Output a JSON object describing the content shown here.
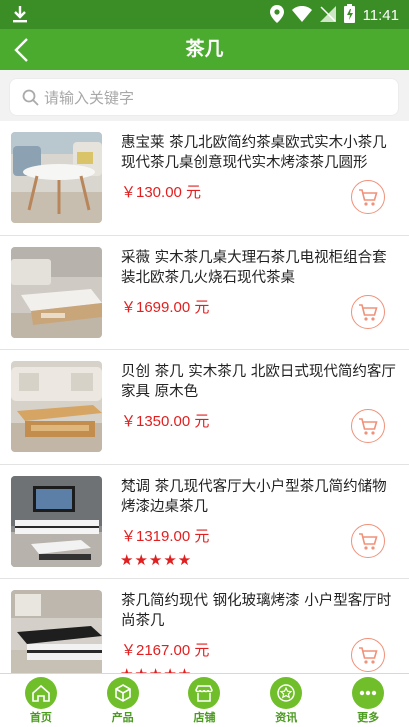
{
  "status_bar": {
    "time": "11:41"
  },
  "header": {
    "title": "茶几"
  },
  "search": {
    "placeholder": "请输入关键字"
  },
  "products": [
    {
      "name": "惠宝莱 茶几北欧简约茶桌欧式实木小茶几现代茶几桌创意现代实木烤漆茶几圆形",
      "price": "￥130.00 元",
      "rating": ""
    },
    {
      "name": "采薇 实木茶几桌大理石茶几电视柜组合套装北欧茶几火烧石现代茶桌",
      "price": "￥1699.00 元",
      "rating": ""
    },
    {
      "name": "贝创 茶几 实木茶几 北欧日式现代简约客厅家具 原木色",
      "price": "￥1350.00 元",
      "rating": ""
    },
    {
      "name": "梵调 茶几现代客厅大小户型茶几简约储物烤漆边桌茶几",
      "price": "￥1319.00 元",
      "rating": "★★★★★"
    },
    {
      "name": " 茶几简约现代 钢化玻璃烤漆 小户型客厅时尚茶几",
      "price": "￥2167.00 元",
      "rating": "★★★★★"
    }
  ],
  "tabbar": {
    "home": "首页",
    "products": "产品",
    "shops": "店铺",
    "news": "资讯",
    "more": "更多"
  },
  "colors": {
    "header": "#4aab2f",
    "status_bar": "#3b8d26",
    "price": "#e02020",
    "tab_icon": "#6fbe2a"
  }
}
